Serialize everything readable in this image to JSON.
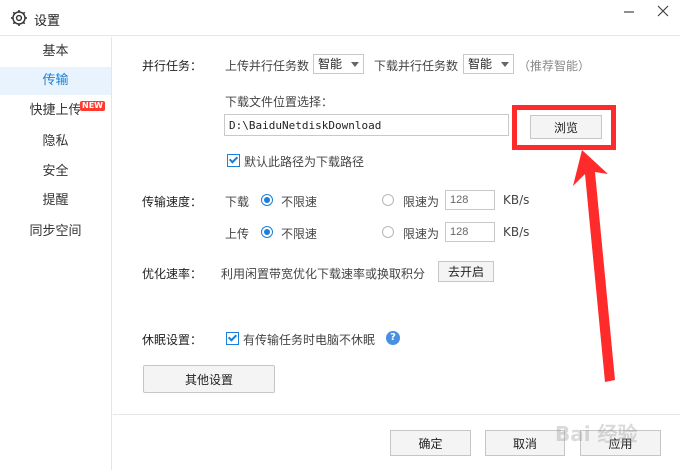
{
  "window": {
    "title": "设置"
  },
  "sidebar": {
    "items": [
      {
        "label": "基本"
      },
      {
        "label": "传输"
      },
      {
        "label": "快捷上传",
        "badge": "NEW"
      },
      {
        "label": "隐私"
      },
      {
        "label": "安全"
      },
      {
        "label": "提醒"
      },
      {
        "label": "同步空间"
      }
    ],
    "active_index": 1
  },
  "parallel": {
    "label": "并行任务：",
    "upload_label": "上传并行任务数",
    "upload_value": "智能",
    "download_label": "下载并行任务数",
    "download_value": "智能",
    "hint": "（推荐智能）"
  },
  "download_location": {
    "label": "下载文件位置选择：",
    "path": "D:\\BaiduNetdiskDownload",
    "browse_label": "浏览",
    "default_checkbox_label": "默认此路径为下载路径",
    "default_checked": true
  },
  "speed": {
    "label": "传输速度：",
    "download_label": "下载",
    "upload_label": "上传",
    "unlimited_label": "不限速",
    "limit_label": "限速为",
    "download_limit_value": "128",
    "upload_limit_value": "128",
    "unit": "KB/s"
  },
  "optimize": {
    "label": "优化速率：",
    "desc": "利用闲置带宽优化下载速率或换取积分",
    "button_label": "去开启"
  },
  "sleep": {
    "label": "休眠设置：",
    "checkbox_label": "有传输任务时电脑不休眠",
    "checked": true,
    "help": "?"
  },
  "other_settings_label": "其他设置",
  "footer": {
    "ok_label": "确定",
    "cancel_label": "取消",
    "apply_label": "应用"
  },
  "watermark": "Bai 经验",
  "colors": {
    "accent": "#1a7fd9",
    "highlight": "#ff2b2b",
    "badge": "#ff3b30"
  }
}
